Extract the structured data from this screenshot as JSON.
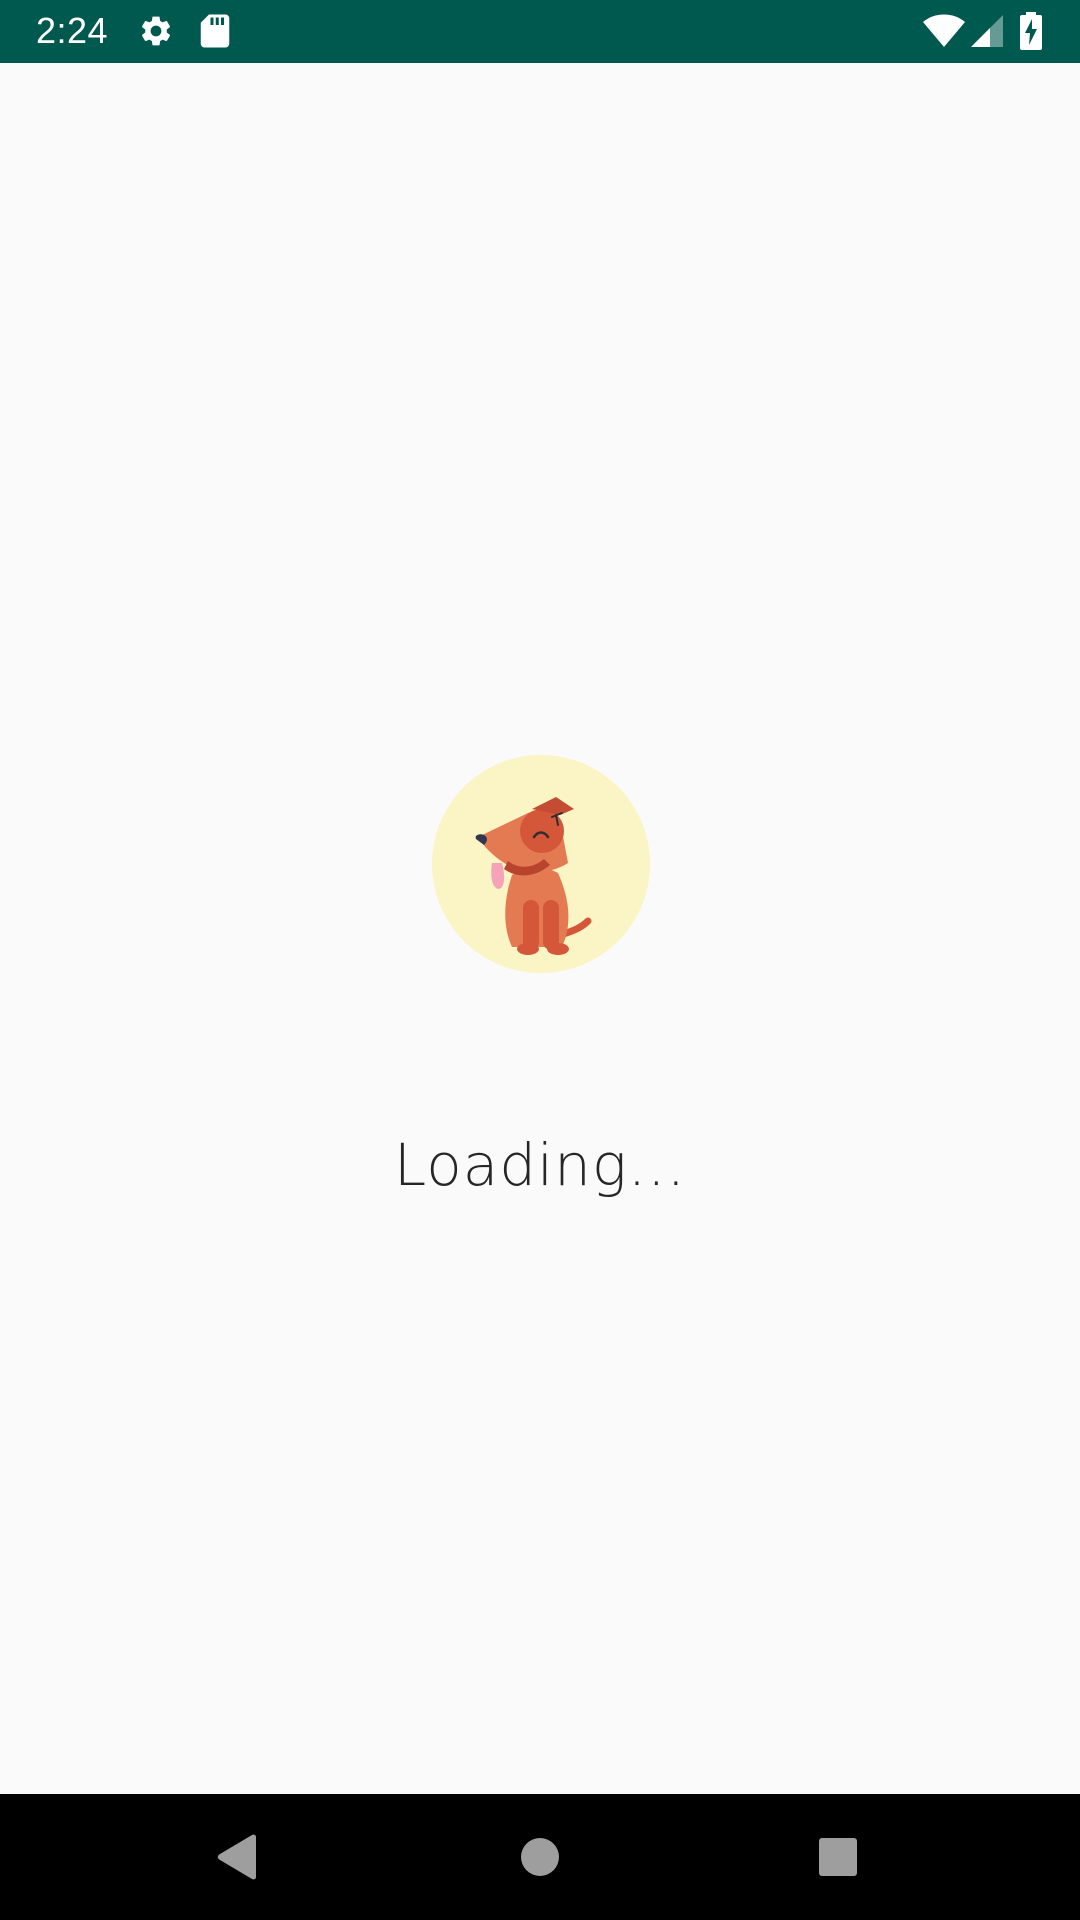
{
  "status_bar": {
    "time": "2:24",
    "background": "#00594f",
    "left_icons": [
      "gear-icon",
      "sd-card-icon"
    ],
    "right_icons": [
      "wifi-icon",
      "cellular-signal-icon",
      "battery-charging-icon"
    ]
  },
  "main": {
    "mascot": "dog-icon",
    "mascot_circle_color": "#fbf4c4",
    "loading_text": "Loading..."
  },
  "nav_bar": {
    "buttons": [
      "back-icon",
      "home-icon",
      "recents-icon"
    ]
  }
}
